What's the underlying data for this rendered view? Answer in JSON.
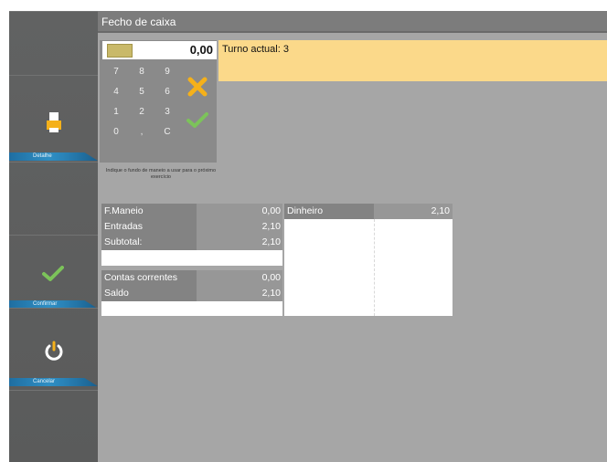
{
  "window": {
    "title": "Fecho de caixa"
  },
  "sidebar": {
    "buttons": [
      {
        "label": "Detalhe",
        "icon": "printer-icon"
      },
      {
        "label": "Confirmar",
        "icon": "check-icon"
      },
      {
        "label": "Cancelar",
        "icon": "power-icon"
      }
    ]
  },
  "keypad": {
    "display_value": "0,00",
    "keys": [
      "7",
      "8",
      "9",
      "4",
      "5",
      "6",
      "1",
      "2",
      "3",
      "0",
      ",",
      "C"
    ],
    "hint": "Indique o fundo de maneio a usar para o próximo exercício"
  },
  "turno": {
    "text": "Turno actual: 3"
  },
  "summary": {
    "rows": [
      {
        "label": "F.Maneio",
        "value": "0,00"
      },
      {
        "label": "Entradas",
        "value": "2,10"
      },
      {
        "label": "Subtotal:",
        "value": "2,10"
      }
    ],
    "rows2": [
      {
        "label": "Contas correntes",
        "value": "0,00"
      },
      {
        "label": "Saldo",
        "value": "2,10"
      }
    ]
  },
  "payments": {
    "label": "Dinheiro",
    "value": "2,10"
  },
  "colors": {
    "accent_orange": "#f5b11a",
    "check_green": "#7cc35a",
    "turno_bg": "#fbd98a",
    "sidebar_label_blue": "#2a84b9"
  }
}
